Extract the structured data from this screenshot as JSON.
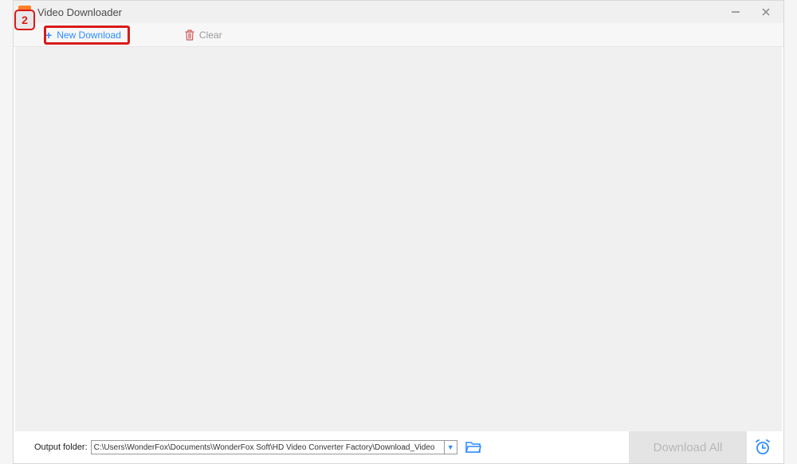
{
  "titlebar": {
    "title": "Video Downloader"
  },
  "toolbar": {
    "new_download_label": "New Download",
    "clear_label": "Clear"
  },
  "footer": {
    "output_label": "Output folder:",
    "output_path": "C:\\Users\\WonderFox\\Documents\\WonderFox Soft\\HD Video Converter Factory\\Download_Video",
    "download_all_label": "Download All"
  },
  "annotation": {
    "step_number": "2"
  }
}
